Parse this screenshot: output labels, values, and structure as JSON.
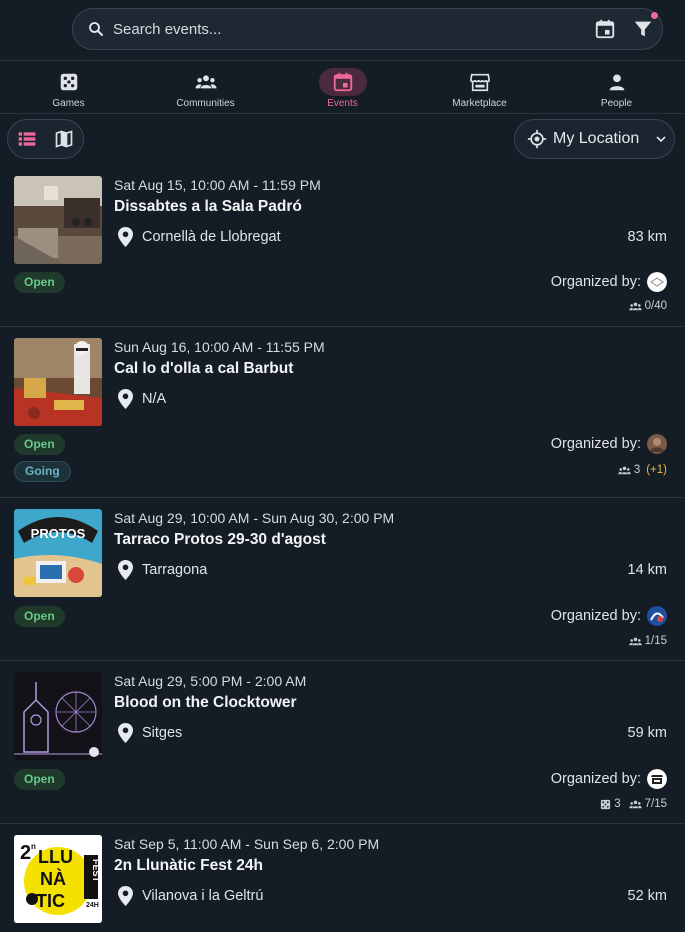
{
  "search": {
    "placeholder": "Search events..."
  },
  "tabs": [
    {
      "label": "Games",
      "icon": "dice-icon",
      "active": false
    },
    {
      "label": "Communities",
      "icon": "people-group-icon",
      "active": false
    },
    {
      "label": "Events",
      "icon": "calendar-icon",
      "active": true
    },
    {
      "label": "Marketplace",
      "icon": "store-icon",
      "active": false
    },
    {
      "label": "People",
      "icon": "person-icon",
      "active": false
    }
  ],
  "location_button": {
    "label": "My Location"
  },
  "colors": {
    "accent": "#f0689b",
    "open_chip": "#66c98a",
    "going_chip": "#6ab3c4",
    "plus": "#f2b43a"
  },
  "events": [
    {
      "date": "Sat Aug 15, 10:00 AM - 11:59 PM",
      "title": "Dissabtes a la Sala Padró",
      "location": "Cornellà de Llobregat",
      "distance": "83 km",
      "chips": [
        "Open"
      ],
      "organized_label": "Organized by:",
      "attendees": "0/40"
    },
    {
      "date": "Sun Aug 16, 10:00 AM - 11:55 PM",
      "title": "Cal lo d'olla a cal Barbut",
      "location": "N/A",
      "distance": "",
      "chips": [
        "Open",
        "Going"
      ],
      "organized_label": "Organized by:",
      "attendees": "3",
      "attendees_plus": "(+1)"
    },
    {
      "date": "Sat Aug 29, 10:00 AM - Sun Aug 30, 2:00 PM",
      "title": "Tarraco Protos 29-30 d'agost",
      "location": "Tarragona",
      "distance": "14 km",
      "chips": [
        "Open"
      ],
      "organized_label": "Organized by:",
      "attendees": "1/15"
    },
    {
      "date": "Sat Aug 29, 5:00 PM - 2:00 AM",
      "title": "Blood on the Clocktower",
      "location": "Sitges",
      "distance": "59 km",
      "chips": [
        "Open"
      ],
      "organized_label": "Organized by:",
      "games": "3",
      "attendees": "7/15"
    },
    {
      "date": "Sat Sep 5, 11:00 AM - Sun Sep 6, 2:00 PM",
      "title": "2n Llunàtic Fest 24h",
      "location": "Vilanova i la Geltrú",
      "distance": "52 km"
    }
  ],
  "thumb_text": {
    "protos": "PROTOS",
    "fest_l1": "LLU",
    "fest_l2": "NÀ",
    "fest_l3": "TIC",
    "fest_side": "FEST",
    "fest_num": "2",
    "fest_sub": "n",
    "fest_24": "24H"
  }
}
